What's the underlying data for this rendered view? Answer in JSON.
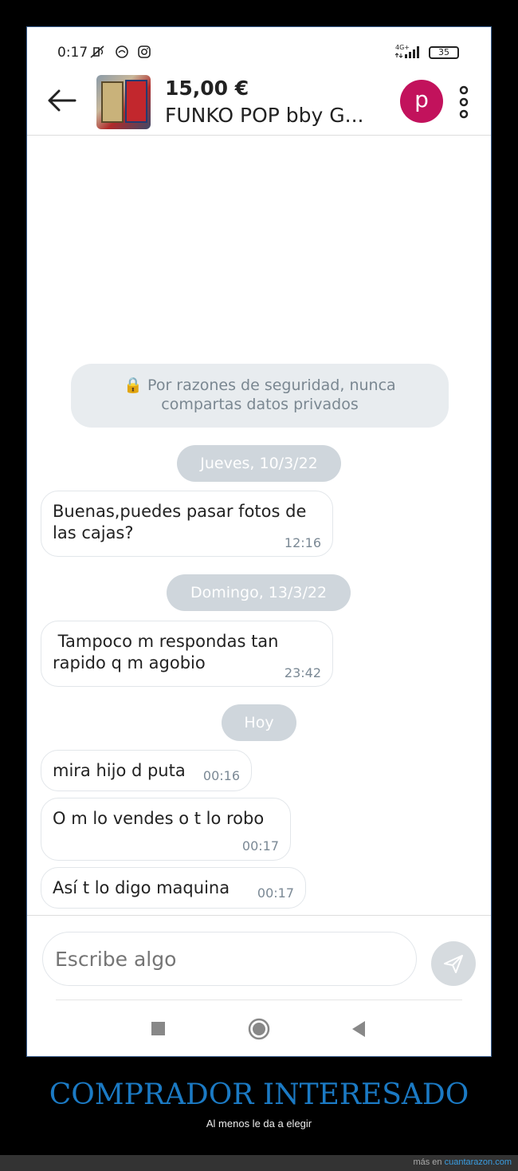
{
  "status_bar": {
    "time": "0:17",
    "network": "4G+",
    "battery": "35",
    "icons": [
      "mute-icon",
      "cloud-icon",
      "instagram-icon"
    ]
  },
  "header": {
    "price": "15,00 €",
    "title": "FUNKO POP bby G...",
    "avatar_letter": "p",
    "avatar_color": "#c2125c"
  },
  "chat": {
    "security_notice": {
      "icon": "🔒",
      "line1": "Por razones de seguridad, nunca",
      "line2": "compartas datos privados"
    },
    "groups": [
      {
        "date": "Jueves, 10/3/22",
        "messages": [
          {
            "line1": "Buenas,puedes pasar fotos de",
            "line2": "las cajas?",
            "time": "12:16"
          }
        ]
      },
      {
        "date": "Domingo, 13/3/22",
        "messages": [
          {
            "line1": " Tampoco m respondas tan",
            "line2": "rapido q m agobio",
            "time": "23:42"
          }
        ]
      },
      {
        "date": "Hoy",
        "messages": [
          {
            "line1": "mira hijo d puta",
            "time": "00:16"
          },
          {
            "line1": "O m lo vendes o t lo robo",
            "time": "00:17"
          },
          {
            "line1": "Así t lo digo maquina",
            "time": "00:17"
          }
        ]
      }
    ]
  },
  "composer": {
    "placeholder": "Escribe algo"
  },
  "caption": {
    "title": "COMPRADOR INTERESADO",
    "subtitle": "Al menos le da a elegir",
    "footer_prefix": "más en ",
    "footer_site": "cuantarazon.com"
  },
  "colors": {
    "accent": "#c2125c",
    "caption_blue": "#1b7ac4",
    "pill_bg": "#cfd6dc",
    "notice_bg": "#e8ecef"
  }
}
